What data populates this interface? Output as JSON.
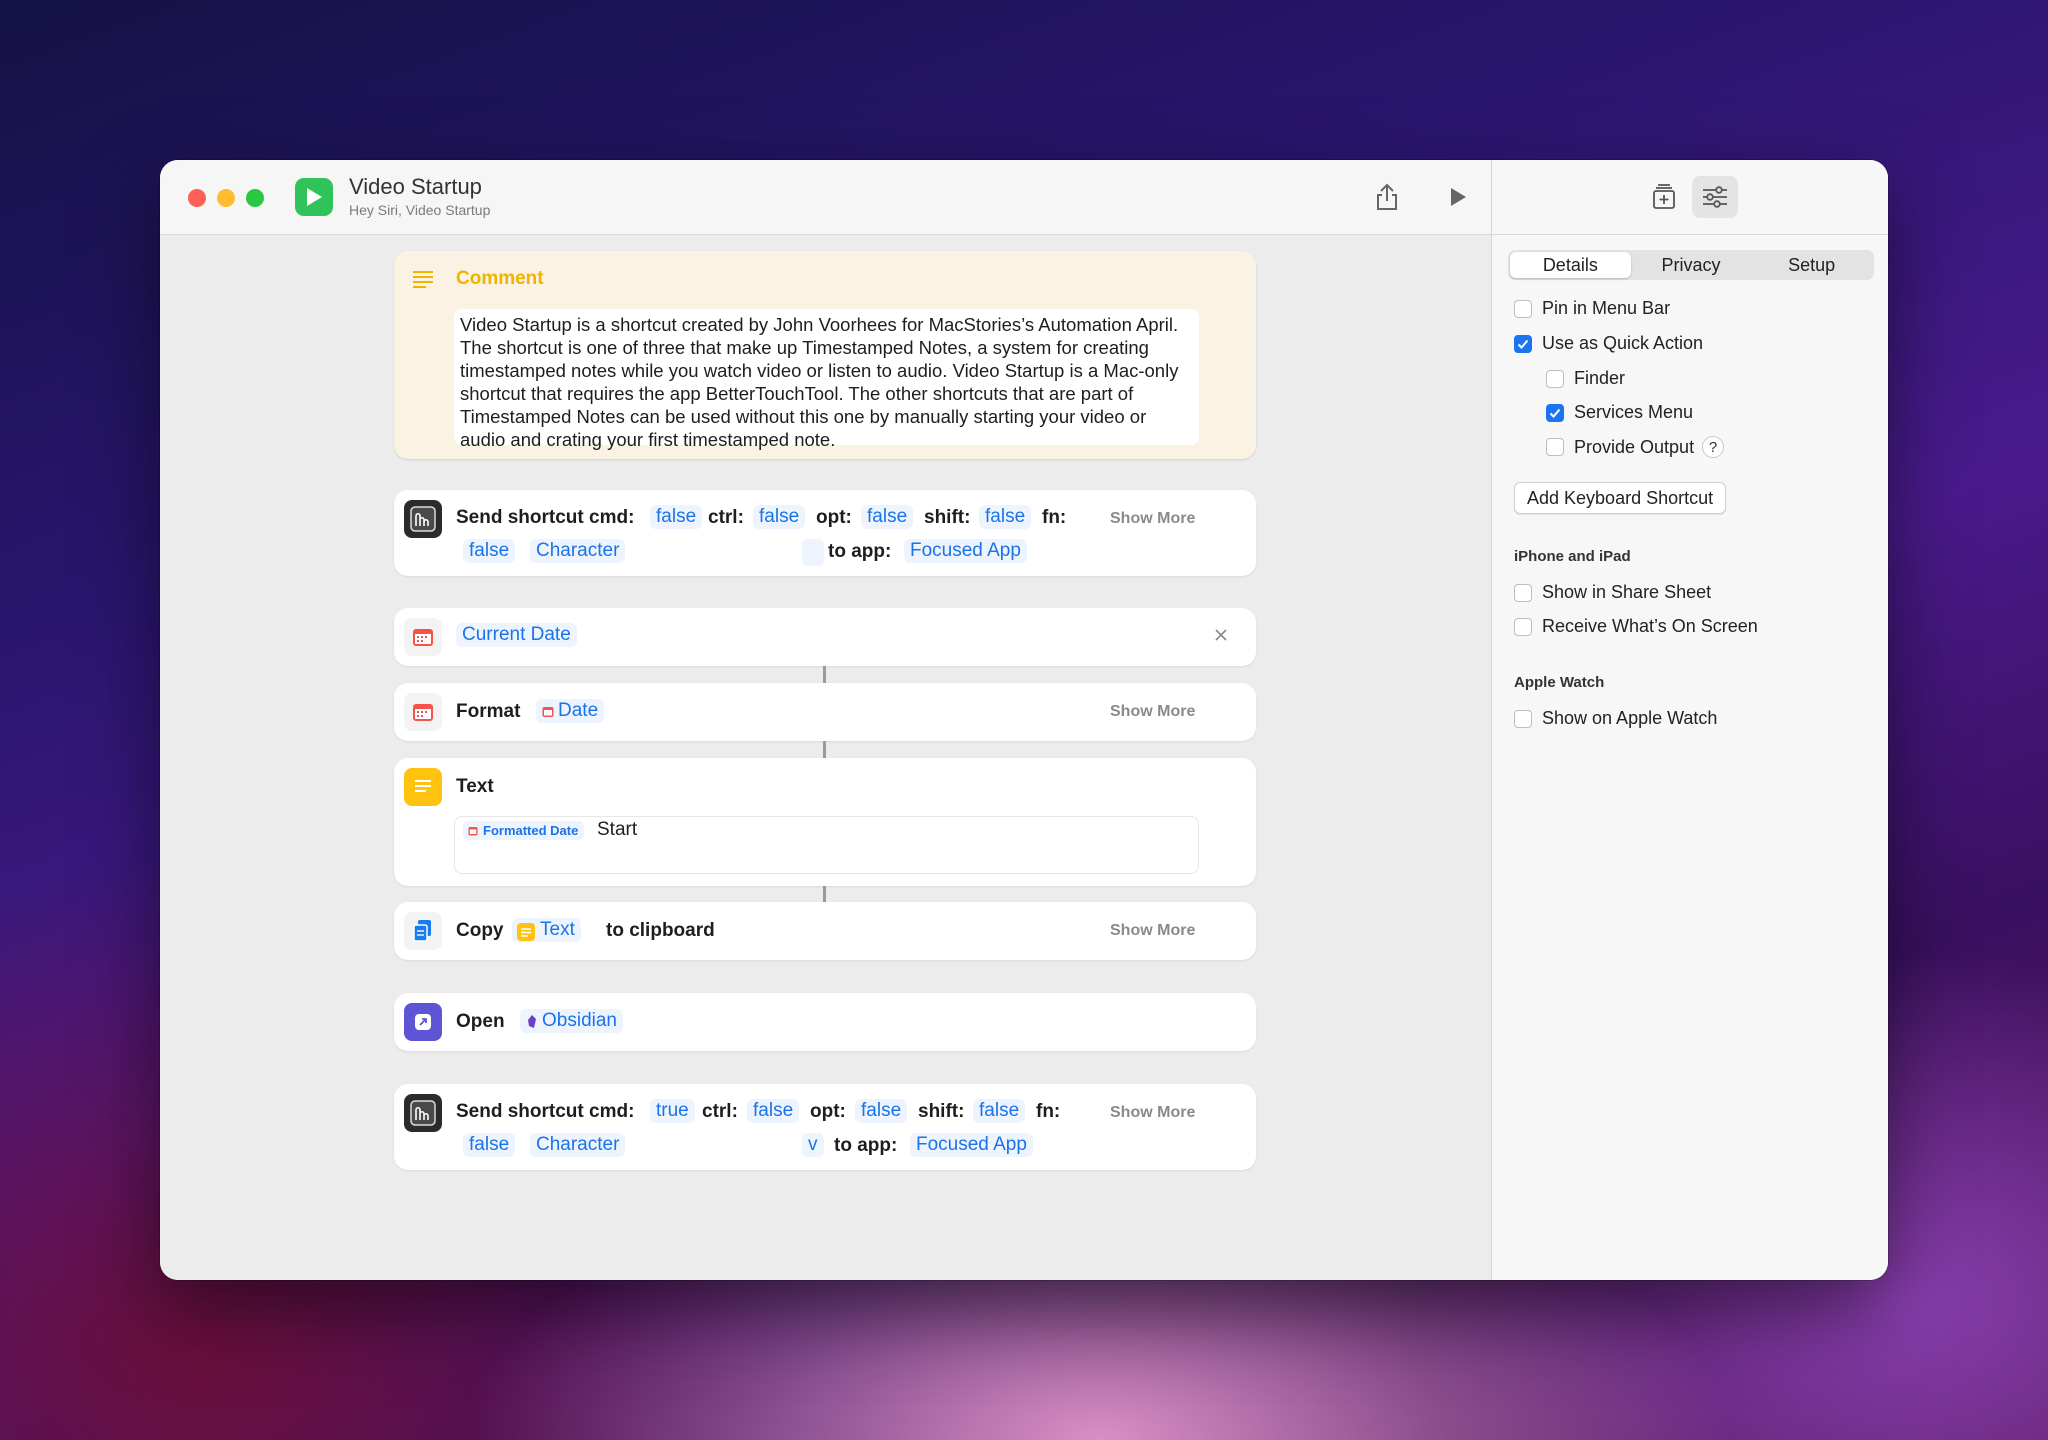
{
  "window": {
    "title": "Video Startup",
    "subtitle": "Hey Siri, Video Startup"
  },
  "sidebar": {
    "tabs": [
      "Details",
      "Privacy",
      "Setup"
    ],
    "active_tab": "Details",
    "options": {
      "pin_menu_bar": "Pin in Menu Bar",
      "quick_action": "Use as Quick Action",
      "finder": "Finder",
      "services_menu": "Services Menu",
      "provide_output": "Provide Output",
      "help": "?"
    },
    "add_keyboard_shortcut": "Add Keyboard Shortcut",
    "iphone_heading": "iPhone and iPad",
    "share_sheet": "Show in Share Sheet",
    "receive_screen": "Receive What’s On Screen",
    "watch_heading": "Apple Watch",
    "show_watch": "Show on Apple Watch"
  },
  "actions": {
    "comment": {
      "title": "Comment",
      "body": "Video Startup is a shortcut created by John Voorhees for MacStories’s Automation April. The shortcut is one of three that make up Timestamped Notes, a system for creating timestamped notes while you watch video or listen to audio. Video Startup is a Mac-only shortcut that requires the app BetterTouchTool. The other shortcuts that are part of Timestamped Notes can be used without this one by manually starting your video or audio and crating your first timestamped note."
    },
    "send1": {
      "label": "Send shortcut cmd:",
      "cmd": "false",
      "ctrl_label": "ctrl:",
      "ctrl": "false",
      "opt_label": "opt:",
      "opt": "false",
      "shift_label": "shift:",
      "shift": "false",
      "fn_label": "fn:",
      "fn": "false",
      "character": "Character",
      "key": "",
      "to_app_label": "to app:",
      "app": "Focused App",
      "show_more": "Show More"
    },
    "current_date": {
      "token": "Current Date"
    },
    "format": {
      "label": "Format",
      "token": "Date",
      "show_more": "Show More"
    },
    "text": {
      "label": "Text",
      "token": "Formatted Date",
      "value": "Start"
    },
    "copy": {
      "label": "Copy",
      "token": "Text",
      "suffix": "to clipboard",
      "show_more": "Show More"
    },
    "open": {
      "label": "Open",
      "token": "Obsidian"
    },
    "send2": {
      "label": "Send shortcut cmd:",
      "cmd": "true",
      "ctrl_label": "ctrl:",
      "ctrl": "false",
      "opt_label": "opt:",
      "opt": "false",
      "shift_label": "shift:",
      "shift": "false",
      "fn_label": "fn:",
      "fn": "false",
      "character": "Character",
      "key": "v",
      "to_app_label": "to app:",
      "app": "Focused App",
      "show_more": "Show More"
    }
  },
  "colors": {
    "accent": "#1a73e8",
    "comment_bg": "#faf3e4",
    "comment_title": "#f0b400",
    "run_icon_green": "#30c35a"
  }
}
